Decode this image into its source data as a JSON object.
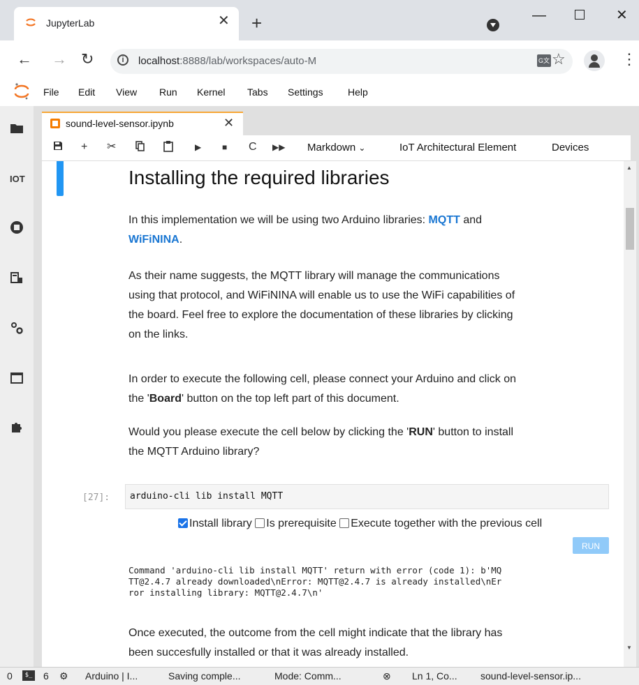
{
  "browser": {
    "tab_title": "JupyterLab",
    "new_tab": "+",
    "tab_close": "✕",
    "url_host": "localhost",
    "url_rest": ":8888/lab/workspaces/auto-M"
  },
  "jupyter": {
    "menu": [
      "File",
      "Edit",
      "View",
      "Run",
      "Kernel",
      "Tabs",
      "Settings",
      "Help"
    ],
    "notebook_tab": "sound-level-sensor.ipynb",
    "sidebar_iot_label": "IOT",
    "toolbar": {
      "cell_type": "Markdown",
      "extra1": "IoT Architectural Element",
      "extra2": "Devices"
    }
  },
  "notebook": {
    "heading": "Installing the required libraries",
    "p1_pre": "In this implementation we will be using two Arduino libraries: ",
    "p1_link1": "MQTT",
    "p1_mid": " and",
    "p1_link2": "WiFiNINA",
    "p1_post": ".",
    "p2_line1": "As their name suggests, the MQTT library will manage the communications",
    "p2_line2": "using that protocol, and WiFiNINA will enable us to use the WiFi capabilities of",
    "p2_line3": "the board. Feel free to explore the documentation of these libraries by clicking",
    "p2_line4": "on the links.",
    "p3_line1": "In order to execute the following cell, please connect your Arduino and click on",
    "p3_pre": "the '",
    "p3_bold": "Board",
    "p3_post": "' button on the top left part of this document.",
    "p4_pre": "Would you please execute the cell below by clicking the '",
    "p4_bold": "RUN",
    "p4_post": "' button to install",
    "p4_line2": "the MQTT Arduino library?",
    "prompt": "[27]:",
    "code": "arduino-cli lib install MQTT",
    "check1": "Install library",
    "check2": "Is prerequisite",
    "check3": "Execute together with the previous cell",
    "run": "RUN",
    "output_line1": "Command 'arduino-cli lib install MQTT' return with error (code 1): b'MQ",
    "output_line2": "TT@2.4.7 already downloaded\\nError: MQTT@2.4.7 is already installed\\nEr",
    "output_line3": "ror installing library: MQTT@2.4.7\\n'",
    "p5_line1": "Once executed, the outcome from the cell might indicate that the library has",
    "p5_line2": "been succesfully installed or that it was already installed."
  },
  "status": {
    "zero": "0",
    "six": "6",
    "arduino": "Arduino | I...",
    "saving": "Saving comple...",
    "mode": "Mode: Comm...",
    "ln": "Ln 1, Co...",
    "file": "sound-level-sensor.ip..."
  }
}
